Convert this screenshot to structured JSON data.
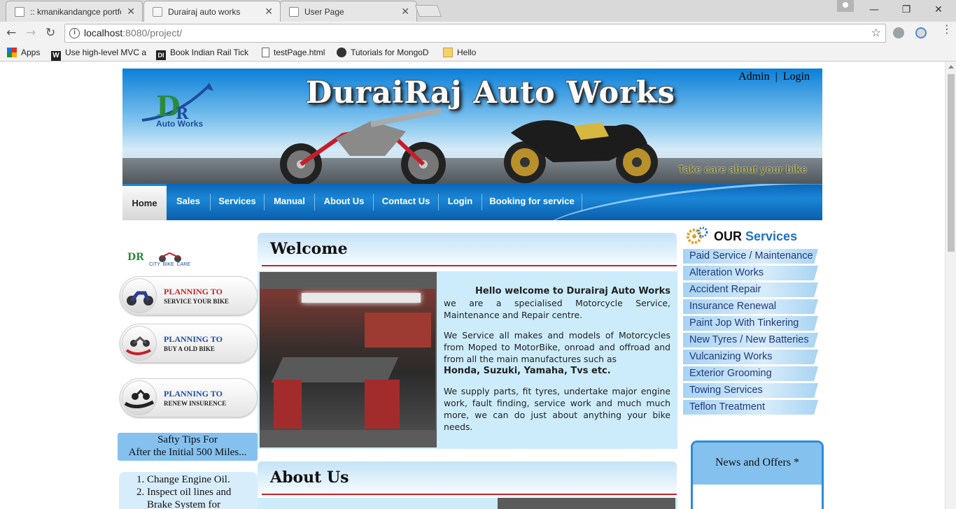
{
  "browser": {
    "tabs": [
      {
        "title": ":: kmanikandangce portfo",
        "active": false
      },
      {
        "title": "Durairaj auto works",
        "active": true
      },
      {
        "title": "User Page",
        "active": false
      }
    ],
    "url_host": "localhost",
    "url_path": ":8080/project/",
    "bookmarks": [
      {
        "label": "Apps",
        "icon": "apps-grid-icon"
      },
      {
        "label": "Use high-level MVC a",
        "icon": "w-site-icon"
      },
      {
        "label": "Book Indian Rail Tick",
        "icon": "di-site-icon"
      },
      {
        "label": "testPage.html",
        "icon": "document-icon"
      },
      {
        "label": "Tutorials for MongoD",
        "icon": "mongo-icon"
      },
      {
        "label": "Hello",
        "icon": "folder-icon"
      }
    ]
  },
  "banner": {
    "title": "DuraiRaj Auto Works",
    "logo_text": "Auto Works",
    "admin_link": "Admin",
    "divider": "|",
    "login_link": "Login",
    "tagline": "Take care about your bike"
  },
  "nav": {
    "items": [
      {
        "label": "Home",
        "active": true
      },
      {
        "label": "Sales"
      },
      {
        "label": "Services"
      },
      {
        "label": "Manual"
      },
      {
        "label": "About Us"
      },
      {
        "label": "Contact Us"
      },
      {
        "label": "Login"
      },
      {
        "label": "Booking for service"
      }
    ]
  },
  "left": {
    "logo_caption": "CITY  BIKE  CARE",
    "plans": [
      {
        "line1": "PLANNING TO",
        "line2": "SERVICE YOUR BIKE"
      },
      {
        "line1": "PLANNING TO",
        "line2": "BUY A OLD BIKE"
      },
      {
        "line1": "PLANNING TO",
        "line2": "RENEW INSURENCE"
      }
    ],
    "tips_title_1": "Safty Tips For",
    "tips_title_2": "After the Initial 500 Miles...",
    "tips": [
      "Change Engine Oil.",
      "Inspect oil lines and",
      "Brake System for"
    ]
  },
  "welcome": {
    "heading": "Welcome",
    "greeting": "Hello welcome to Durairaj Auto Works",
    "p1": "we are a specialised Motorcycle Service, Maintenance and Repair centre.",
    "p2": "We Service all makes and models of Motorcycles from Moped to MotorBike, onroad and offroad and from all the main manufactures such as",
    "brands": "Honda, Suzuki, Yamaha, Tvs etc.",
    "p3": "We supply parts, fit tyres, undertake major engine work, fault finding, service work and much much more, we can do just about anything your bike needs."
  },
  "about": {
    "heading": "About Us"
  },
  "services": {
    "heading_our": "OUR",
    "heading_services": "Services",
    "items": [
      "Paid Service / Maintenance",
      "Alteration Works",
      "Accident Repair",
      "Insurance Renewal",
      "Paint Jop With Tinkering",
      "New Tyres / New Batteries",
      "Vulcanizing Works",
      "Exterior Grooming",
      "Towing Services",
      "Teflon Treatment"
    ]
  },
  "news": {
    "title": "News and Offers *"
  },
  "colors": {
    "nav_blue": "#0b64b5",
    "accent_red": "#c81e2a",
    "light_blue": "#ccecfb",
    "tab_blue": "#85c1ee"
  }
}
